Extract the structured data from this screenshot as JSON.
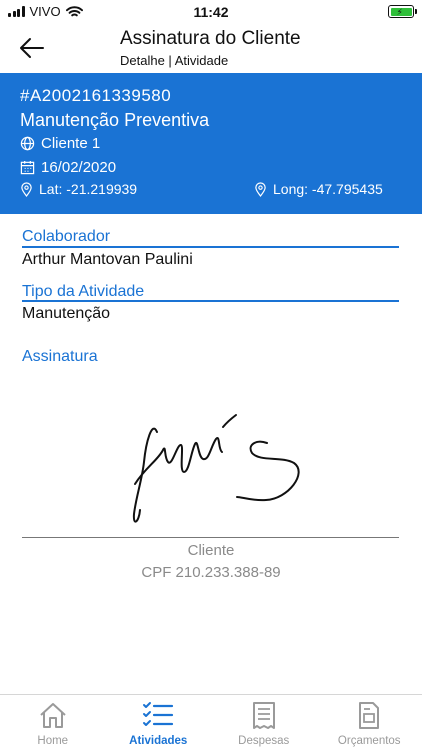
{
  "status_bar": {
    "carrier": "VIVO",
    "time": "11:42"
  },
  "header": {
    "title": "Assinatura do Cliente",
    "subtitle": "Detalhe | Atividade"
  },
  "card": {
    "code": "#A2002161339580",
    "activity_type": "Manutenção Preventiva",
    "client": "Cliente 1",
    "date": "16/02/2020",
    "lat": "Lat: -21.219939",
    "long": "Long: -47.795435"
  },
  "fields": {
    "colaborador_label": "Colaborador",
    "colaborador_value": "Arthur Mantovan Paulini",
    "tipo_label": "Tipo da Atividade",
    "tipo_value": "Manutenção",
    "assinatura_label": "Assinatura"
  },
  "signature": {
    "caption": "Cliente",
    "cpf": "CPF 210.233.388-89"
  },
  "tabs": [
    {
      "label": "Home",
      "icon": "home-icon",
      "active": false
    },
    {
      "label": "Atividades",
      "icon": "checklist-icon",
      "active": true
    },
    {
      "label": "Despesas",
      "icon": "receipt-icon",
      "active": false
    },
    {
      "label": "Orçamentos",
      "icon": "document-icon",
      "active": false
    }
  ],
  "colors": {
    "accent": "#1a73d4",
    "battery": "#2fbf3a",
    "inactive_tab": "#9a9a9a"
  }
}
